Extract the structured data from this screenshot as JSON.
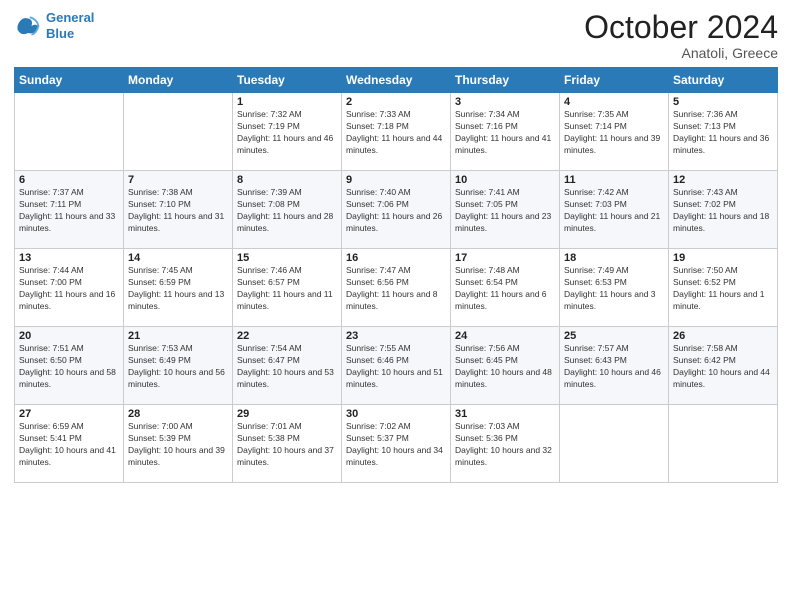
{
  "header": {
    "logo_line1": "General",
    "logo_line2": "Blue",
    "month": "October 2024",
    "location": "Anatoli, Greece"
  },
  "days_of_week": [
    "Sunday",
    "Monday",
    "Tuesday",
    "Wednesday",
    "Thursday",
    "Friday",
    "Saturday"
  ],
  "weeks": [
    [
      {
        "day": "",
        "sunrise": "",
        "sunset": "",
        "daylight": ""
      },
      {
        "day": "",
        "sunrise": "",
        "sunset": "",
        "daylight": ""
      },
      {
        "day": "1",
        "sunrise": "Sunrise: 7:32 AM",
        "sunset": "Sunset: 7:19 PM",
        "daylight": "Daylight: 11 hours and 46 minutes."
      },
      {
        "day": "2",
        "sunrise": "Sunrise: 7:33 AM",
        "sunset": "Sunset: 7:18 PM",
        "daylight": "Daylight: 11 hours and 44 minutes."
      },
      {
        "day": "3",
        "sunrise": "Sunrise: 7:34 AM",
        "sunset": "Sunset: 7:16 PM",
        "daylight": "Daylight: 11 hours and 41 minutes."
      },
      {
        "day": "4",
        "sunrise": "Sunrise: 7:35 AM",
        "sunset": "Sunset: 7:14 PM",
        "daylight": "Daylight: 11 hours and 39 minutes."
      },
      {
        "day": "5",
        "sunrise": "Sunrise: 7:36 AM",
        "sunset": "Sunset: 7:13 PM",
        "daylight": "Daylight: 11 hours and 36 minutes."
      }
    ],
    [
      {
        "day": "6",
        "sunrise": "Sunrise: 7:37 AM",
        "sunset": "Sunset: 7:11 PM",
        "daylight": "Daylight: 11 hours and 33 minutes."
      },
      {
        "day": "7",
        "sunrise": "Sunrise: 7:38 AM",
        "sunset": "Sunset: 7:10 PM",
        "daylight": "Daylight: 11 hours and 31 minutes."
      },
      {
        "day": "8",
        "sunrise": "Sunrise: 7:39 AM",
        "sunset": "Sunset: 7:08 PM",
        "daylight": "Daylight: 11 hours and 28 minutes."
      },
      {
        "day": "9",
        "sunrise": "Sunrise: 7:40 AM",
        "sunset": "Sunset: 7:06 PM",
        "daylight": "Daylight: 11 hours and 26 minutes."
      },
      {
        "day": "10",
        "sunrise": "Sunrise: 7:41 AM",
        "sunset": "Sunset: 7:05 PM",
        "daylight": "Daylight: 11 hours and 23 minutes."
      },
      {
        "day": "11",
        "sunrise": "Sunrise: 7:42 AM",
        "sunset": "Sunset: 7:03 PM",
        "daylight": "Daylight: 11 hours and 21 minutes."
      },
      {
        "day": "12",
        "sunrise": "Sunrise: 7:43 AM",
        "sunset": "Sunset: 7:02 PM",
        "daylight": "Daylight: 11 hours and 18 minutes."
      }
    ],
    [
      {
        "day": "13",
        "sunrise": "Sunrise: 7:44 AM",
        "sunset": "Sunset: 7:00 PM",
        "daylight": "Daylight: 11 hours and 16 minutes."
      },
      {
        "day": "14",
        "sunrise": "Sunrise: 7:45 AM",
        "sunset": "Sunset: 6:59 PM",
        "daylight": "Daylight: 11 hours and 13 minutes."
      },
      {
        "day": "15",
        "sunrise": "Sunrise: 7:46 AM",
        "sunset": "Sunset: 6:57 PM",
        "daylight": "Daylight: 11 hours and 11 minutes."
      },
      {
        "day": "16",
        "sunrise": "Sunrise: 7:47 AM",
        "sunset": "Sunset: 6:56 PM",
        "daylight": "Daylight: 11 hours and 8 minutes."
      },
      {
        "day": "17",
        "sunrise": "Sunrise: 7:48 AM",
        "sunset": "Sunset: 6:54 PM",
        "daylight": "Daylight: 11 hours and 6 minutes."
      },
      {
        "day": "18",
        "sunrise": "Sunrise: 7:49 AM",
        "sunset": "Sunset: 6:53 PM",
        "daylight": "Daylight: 11 hours and 3 minutes."
      },
      {
        "day": "19",
        "sunrise": "Sunrise: 7:50 AM",
        "sunset": "Sunset: 6:52 PM",
        "daylight": "Daylight: 11 hours and 1 minute."
      }
    ],
    [
      {
        "day": "20",
        "sunrise": "Sunrise: 7:51 AM",
        "sunset": "Sunset: 6:50 PM",
        "daylight": "Daylight: 10 hours and 58 minutes."
      },
      {
        "day": "21",
        "sunrise": "Sunrise: 7:53 AM",
        "sunset": "Sunset: 6:49 PM",
        "daylight": "Daylight: 10 hours and 56 minutes."
      },
      {
        "day": "22",
        "sunrise": "Sunrise: 7:54 AM",
        "sunset": "Sunset: 6:47 PM",
        "daylight": "Daylight: 10 hours and 53 minutes."
      },
      {
        "day": "23",
        "sunrise": "Sunrise: 7:55 AM",
        "sunset": "Sunset: 6:46 PM",
        "daylight": "Daylight: 10 hours and 51 minutes."
      },
      {
        "day": "24",
        "sunrise": "Sunrise: 7:56 AM",
        "sunset": "Sunset: 6:45 PM",
        "daylight": "Daylight: 10 hours and 48 minutes."
      },
      {
        "day": "25",
        "sunrise": "Sunrise: 7:57 AM",
        "sunset": "Sunset: 6:43 PM",
        "daylight": "Daylight: 10 hours and 46 minutes."
      },
      {
        "day": "26",
        "sunrise": "Sunrise: 7:58 AM",
        "sunset": "Sunset: 6:42 PM",
        "daylight": "Daylight: 10 hours and 44 minutes."
      }
    ],
    [
      {
        "day": "27",
        "sunrise": "Sunrise: 6:59 AM",
        "sunset": "Sunset: 5:41 PM",
        "daylight": "Daylight: 10 hours and 41 minutes."
      },
      {
        "day": "28",
        "sunrise": "Sunrise: 7:00 AM",
        "sunset": "Sunset: 5:39 PM",
        "daylight": "Daylight: 10 hours and 39 minutes."
      },
      {
        "day": "29",
        "sunrise": "Sunrise: 7:01 AM",
        "sunset": "Sunset: 5:38 PM",
        "daylight": "Daylight: 10 hours and 37 minutes."
      },
      {
        "day": "30",
        "sunrise": "Sunrise: 7:02 AM",
        "sunset": "Sunset: 5:37 PM",
        "daylight": "Daylight: 10 hours and 34 minutes."
      },
      {
        "day": "31",
        "sunrise": "Sunrise: 7:03 AM",
        "sunset": "Sunset: 5:36 PM",
        "daylight": "Daylight: 10 hours and 32 minutes."
      },
      {
        "day": "",
        "sunrise": "",
        "sunset": "",
        "daylight": ""
      },
      {
        "day": "",
        "sunrise": "",
        "sunset": "",
        "daylight": ""
      }
    ]
  ]
}
